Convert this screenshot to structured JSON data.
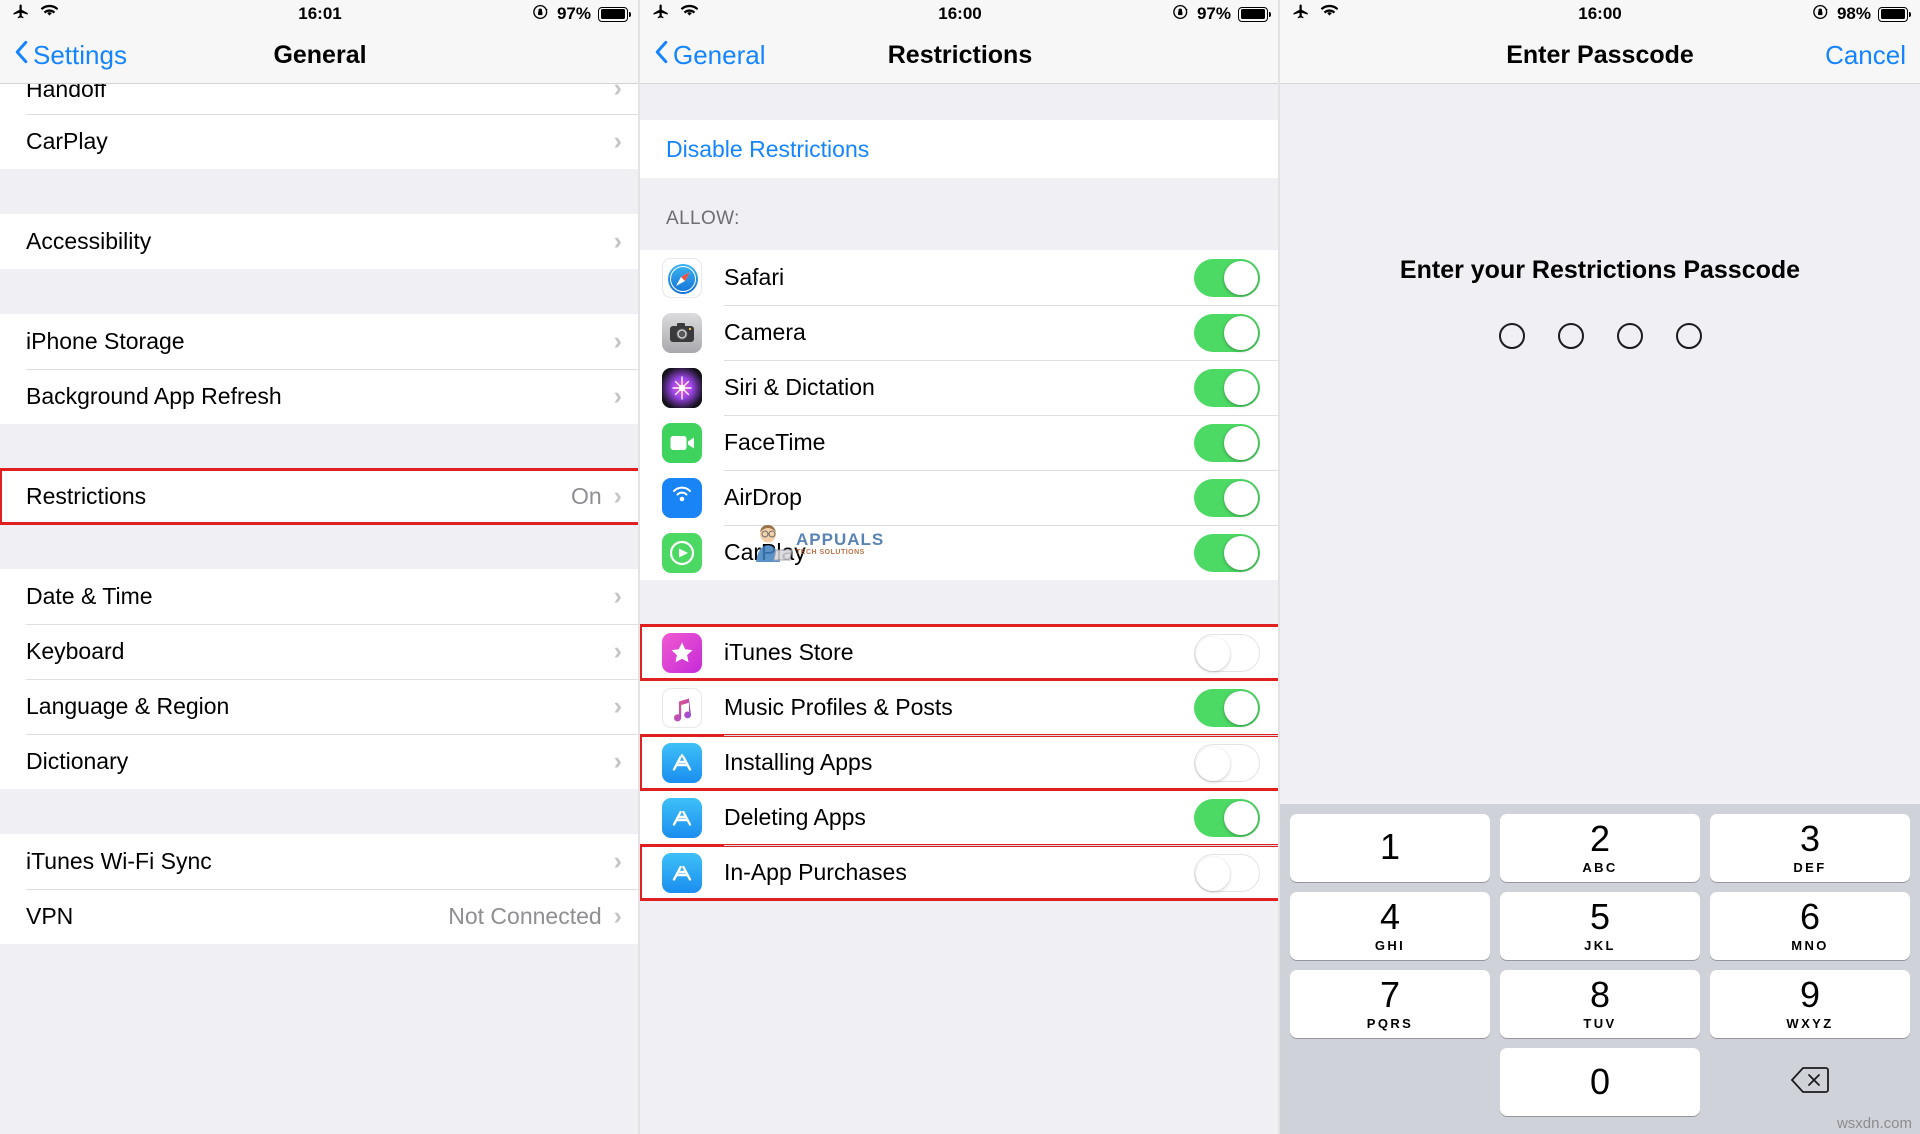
{
  "panel1": {
    "status": {
      "airplane_icon": "airplane-icon",
      "wifi_icon": "wifi-icon",
      "time": "16:01",
      "lock_icon": "rotation-lock-icon",
      "battery_pct": "97%"
    },
    "nav": {
      "back_label": "Settings",
      "title": "General"
    },
    "rows": [
      {
        "label": "Handoff",
        "value": "",
        "chevron": "›",
        "partial": true
      },
      {
        "label": "CarPlay",
        "value": "",
        "chevron": "›"
      },
      {
        "label": "Accessibility",
        "value": "",
        "chevron": "›"
      },
      {
        "label": "iPhone Storage",
        "value": "",
        "chevron": "›"
      },
      {
        "label": "Background App Refresh",
        "value": "",
        "chevron": "›"
      },
      {
        "label": "Restrictions",
        "value": "On",
        "chevron": "›",
        "highlight": true
      },
      {
        "label": "Date & Time",
        "value": "",
        "chevron": "›"
      },
      {
        "label": "Keyboard",
        "value": "",
        "chevron": "›"
      },
      {
        "label": "Language & Region",
        "value": "",
        "chevron": "›"
      },
      {
        "label": "Dictionary",
        "value": "",
        "chevron": "›"
      },
      {
        "label": "iTunes Wi-Fi Sync",
        "value": "",
        "chevron": "›"
      },
      {
        "label": "VPN",
        "value": "Not Connected",
        "chevron": "›"
      }
    ]
  },
  "panel2": {
    "status": {
      "time": "16:00",
      "battery_pct": "97%"
    },
    "nav": {
      "back_label": "General",
      "title": "Restrictions"
    },
    "disable_label": "Disable Restrictions",
    "allow_header": "ALLOW:",
    "allow_items": [
      {
        "label": "Safari",
        "icon": "safari-icon",
        "state": "on"
      },
      {
        "label": "Camera",
        "icon": "camera-icon",
        "state": "on"
      },
      {
        "label": "Siri & Dictation",
        "icon": "siri-icon",
        "state": "on"
      },
      {
        "label": "FaceTime",
        "icon": "facetime-icon",
        "state": "on"
      },
      {
        "label": "AirDrop",
        "icon": "airdrop-icon",
        "state": "on"
      },
      {
        "label": "CarPlay",
        "icon": "carplay-icon",
        "state": "on"
      }
    ],
    "store_items": [
      {
        "label": "iTunes Store",
        "icon": "itunes-store-icon",
        "state": "off",
        "highlight": true
      },
      {
        "label": "Music Profiles & Posts",
        "icon": "music-icon",
        "state": "on",
        "highlight": false
      },
      {
        "label": "Installing Apps",
        "icon": "app-store-icon",
        "state": "off",
        "highlight": true
      },
      {
        "label": "Deleting Apps",
        "icon": "app-store-icon",
        "state": "on",
        "highlight": false
      },
      {
        "label": "In-App Purchases",
        "icon": "app-store-icon",
        "state": "off",
        "highlight": true
      }
    ],
    "watermark": {
      "text": "APPUALS",
      "sub": "TECH SOLUTIONS"
    }
  },
  "panel3": {
    "status": {
      "time": "16:00",
      "battery_pct": "98%"
    },
    "nav": {
      "title": "Enter Passcode",
      "cancel_label": "Cancel"
    },
    "prompt": "Enter your Restrictions Passcode",
    "dots": 4,
    "keys": [
      [
        {
          "num": "1",
          "ltr": ""
        },
        {
          "num": "2",
          "ltr": "ABC"
        },
        {
          "num": "3",
          "ltr": "DEF"
        }
      ],
      [
        {
          "num": "4",
          "ltr": "GHI"
        },
        {
          "num": "5",
          "ltr": "JKL"
        },
        {
          "num": "6",
          "ltr": "MNO"
        }
      ],
      [
        {
          "num": "7",
          "ltr": "PQRS"
        },
        {
          "num": "8",
          "ltr": "TUV"
        },
        {
          "num": "9",
          "ltr": "WXYZ"
        }
      ],
      [
        {
          "num": "",
          "ltr": "",
          "blank": true
        },
        {
          "num": "0",
          "ltr": ""
        },
        {
          "num": "",
          "ltr": "",
          "delete": true
        }
      ]
    ],
    "delete_icon": "backspace-icon",
    "watermark": "wsxdn.com"
  },
  "colors": {
    "accent": "#1585ff",
    "toggle_on": "#4cd964",
    "highlight": "#e02020",
    "group_bg": "#efeff4"
  }
}
